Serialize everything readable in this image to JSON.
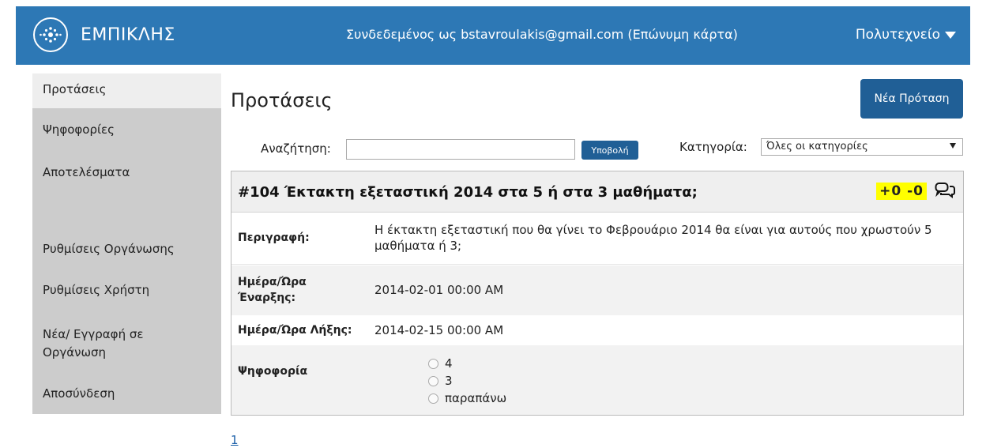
{
  "header": {
    "brand": "ΕΜΠΙΚΛΗΣ",
    "logged_in": "Συνδεδεμένος ως bstavroulakis@gmail.com (Επώνυμη κάρτα)",
    "organization": "Πολυτεχνείο"
  },
  "sidebar": {
    "items": [
      {
        "label": "Προτάσεις"
      },
      {
        "label": "Ψηφοφορίες"
      },
      {
        "label": "Αποτελέσματα"
      },
      {
        "label": "Ρυθμίσεις Οργάνωσης"
      },
      {
        "label": "Ρυθμίσεις Χρήστη"
      },
      {
        "label": "Νέα/ Εγγραφή σε Οργάνωση"
      },
      {
        "label": "Αποσύνδεση"
      }
    ]
  },
  "main": {
    "title": "Προτάσεις",
    "new_button": "Νέα Πρόταση",
    "search_label": "Αναζήτηση:",
    "search_value": "",
    "submit_label": "Υποβολή",
    "category_label": "Κατηγορία:",
    "category_selected": "Όλες οι κατηγορίες",
    "pager": "1"
  },
  "proposal": {
    "title": "#104  Έκτακτη εξεταστική 2014 στα 5 ή στα 3 μαθήματα;",
    "votes": "+0 -0",
    "description_label": "Περιγραφή:",
    "description": "Η έκτακτη εξεταστική που θα γίνει το Φεβρουάριο 2014 θα είναι για αυτούς που χρωστούν 5 μαθήματα ή 3;",
    "start_label": "Ημέρα/Ώρα Έναρξης:",
    "start": "2014-02-01 00:00 AM",
    "end_label": "Ημέρα/Ώρα Λήξης:",
    "end": "2014-02-15 00:00 AM",
    "vote_label": "Ψηφοφορία",
    "options": [
      "4",
      "3",
      "παραπάνω"
    ]
  },
  "colors": {
    "header_bg": "#2d78b5",
    "button_bg": "#205f96",
    "sidebar_bg": "#cccccc",
    "highlight": "#ffff00"
  }
}
